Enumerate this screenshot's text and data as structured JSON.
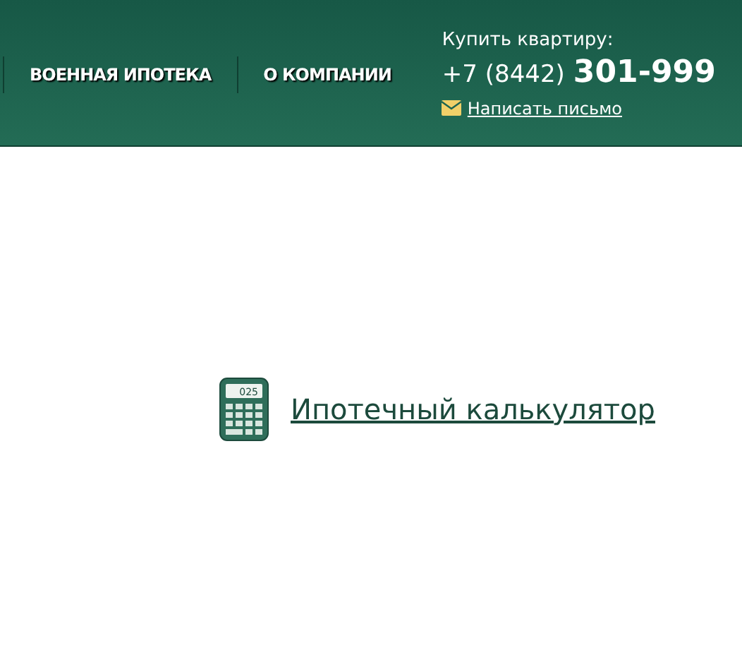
{
  "nav": [
    {
      "label": "ВОЕННАЯ ИПОТЕКА"
    },
    {
      "label": "О КОМПАНИИ"
    }
  ],
  "contact": {
    "caption": "Купить квартиру:",
    "phone_code": "+7 (8442)",
    "phone_number": "301-999",
    "email_link": "Написать письмо"
  },
  "calculator": {
    "display": "025",
    "link": "Ипотечный калькулятор"
  }
}
